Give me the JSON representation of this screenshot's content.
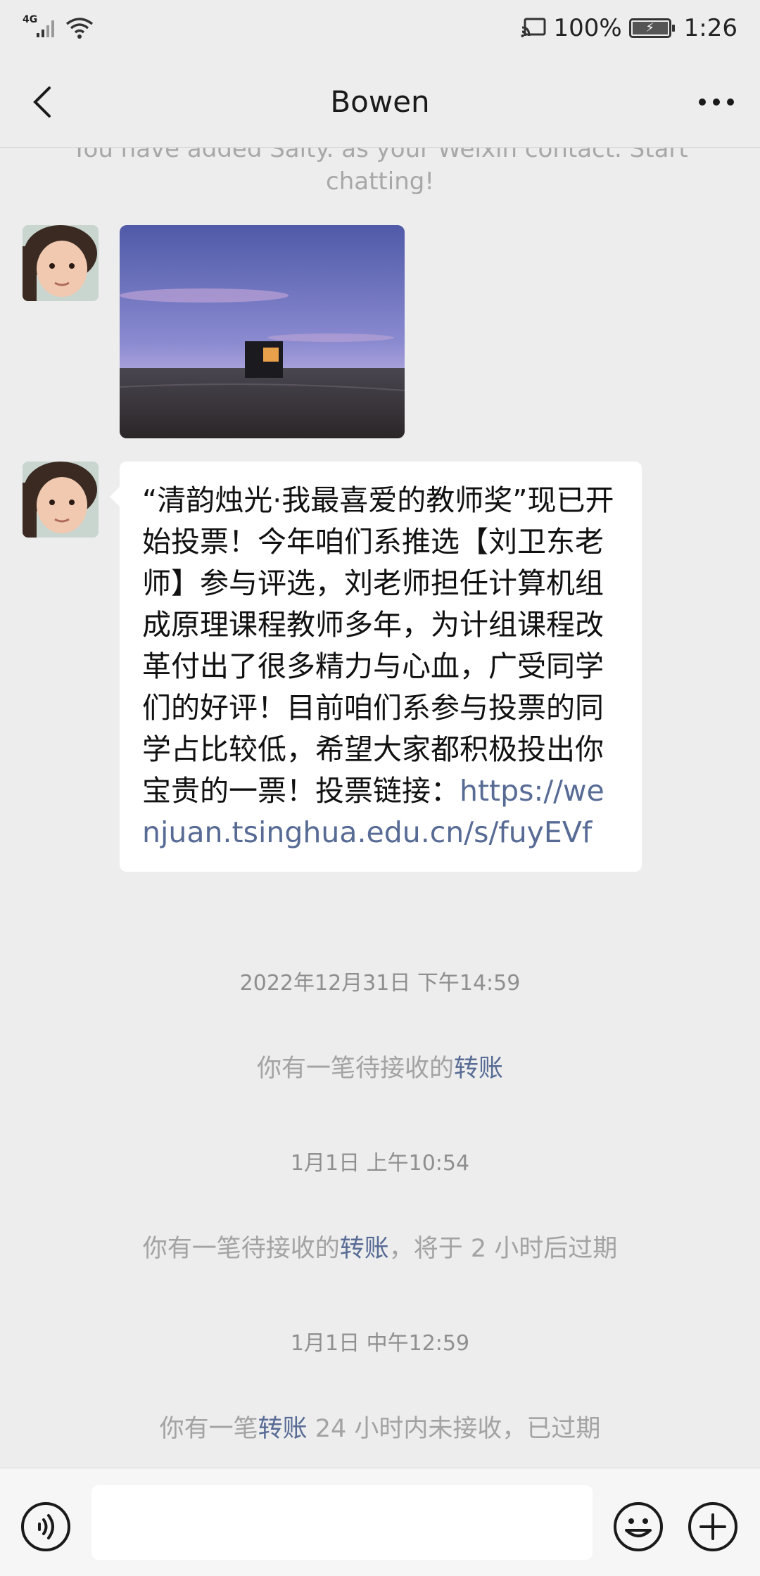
{
  "status_bar": {
    "network": "4G",
    "battery_percent": "100%",
    "time": "1:26",
    "icons": [
      "signal-icon",
      "wifi-icon",
      "cast-icon",
      "battery-icon"
    ]
  },
  "header": {
    "title": "Bowen",
    "back_icon": "chevron-left-icon",
    "more_icon": "more-dots-icon"
  },
  "chat": {
    "system_message_line1": "You have added Salty. as your Weixin contact. Start",
    "system_message_line2": "chatting!",
    "text_message_body": "“清韵烛光·我最喜爱的教师奖”现已开始投票！今年咱们系推选【刘卫东老师】参与评选，刘老师担任计算机组成原理课程教师多年，为计组课程改革付出了很多精力与心血，广受同学们的好评！目前咱们系参与投票的同学占比较低，希望大家都积极投出你宝贵的一票！投票链接：",
    "text_message_link": "https://wenjuan.tsinghua.edu.cn/s/fuyEVf",
    "events": [
      {
        "timestamp": "2022年12月31日 下午14:59",
        "prefix": "你有一笔待接收的",
        "link": "转账",
        "suffix": ""
      },
      {
        "timestamp": "1月1日 上午10:54",
        "prefix": "你有一笔待接收的",
        "link": "转账",
        "suffix": "，将于 2 小时后过期"
      },
      {
        "timestamp": "1月1日 中午12:59",
        "prefix": "你有一笔",
        "link": "转账",
        "suffix": " 24 小时内未接收，已过期"
      }
    ]
  },
  "input_bar": {
    "voice_icon": "voice-icon",
    "emoji_icon": "emoji-icon",
    "plus_icon": "plus-icon",
    "text_value": ""
  },
  "colors": {
    "background": "#ededed",
    "link": "#576b95",
    "bubble": "#ffffff"
  }
}
